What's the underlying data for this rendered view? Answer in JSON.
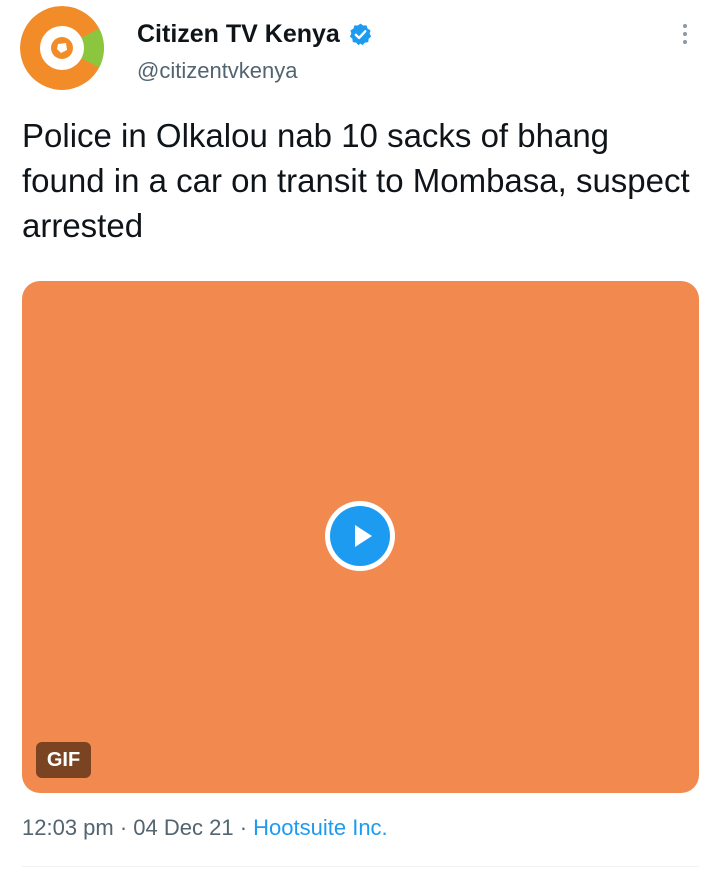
{
  "header": {
    "display_name": "Citizen TV Kenya",
    "handle": "@citizentvkenya",
    "verified_icon": "verified-badge-icon",
    "avatar_colors": {
      "ring_orange": "#f28c28",
      "ring_green": "#8cc63f",
      "center": "#ffffff"
    },
    "more_icon": "vertical-ellipsis-icon"
  },
  "tweet": {
    "text": "Police in Olkalou nab 10 sacks of bhang found in a car on transit to Mombasa, suspect arrested"
  },
  "media": {
    "background_color": "#f2894f",
    "play_icon": "play-icon",
    "badge": "GIF"
  },
  "meta": {
    "time": "12:03 pm",
    "separator": " · ",
    "date": "04 Dec 21",
    "source": "Hootsuite Inc."
  },
  "colors": {
    "accent": "#1d9bf0",
    "secondary_text": "#536471"
  }
}
